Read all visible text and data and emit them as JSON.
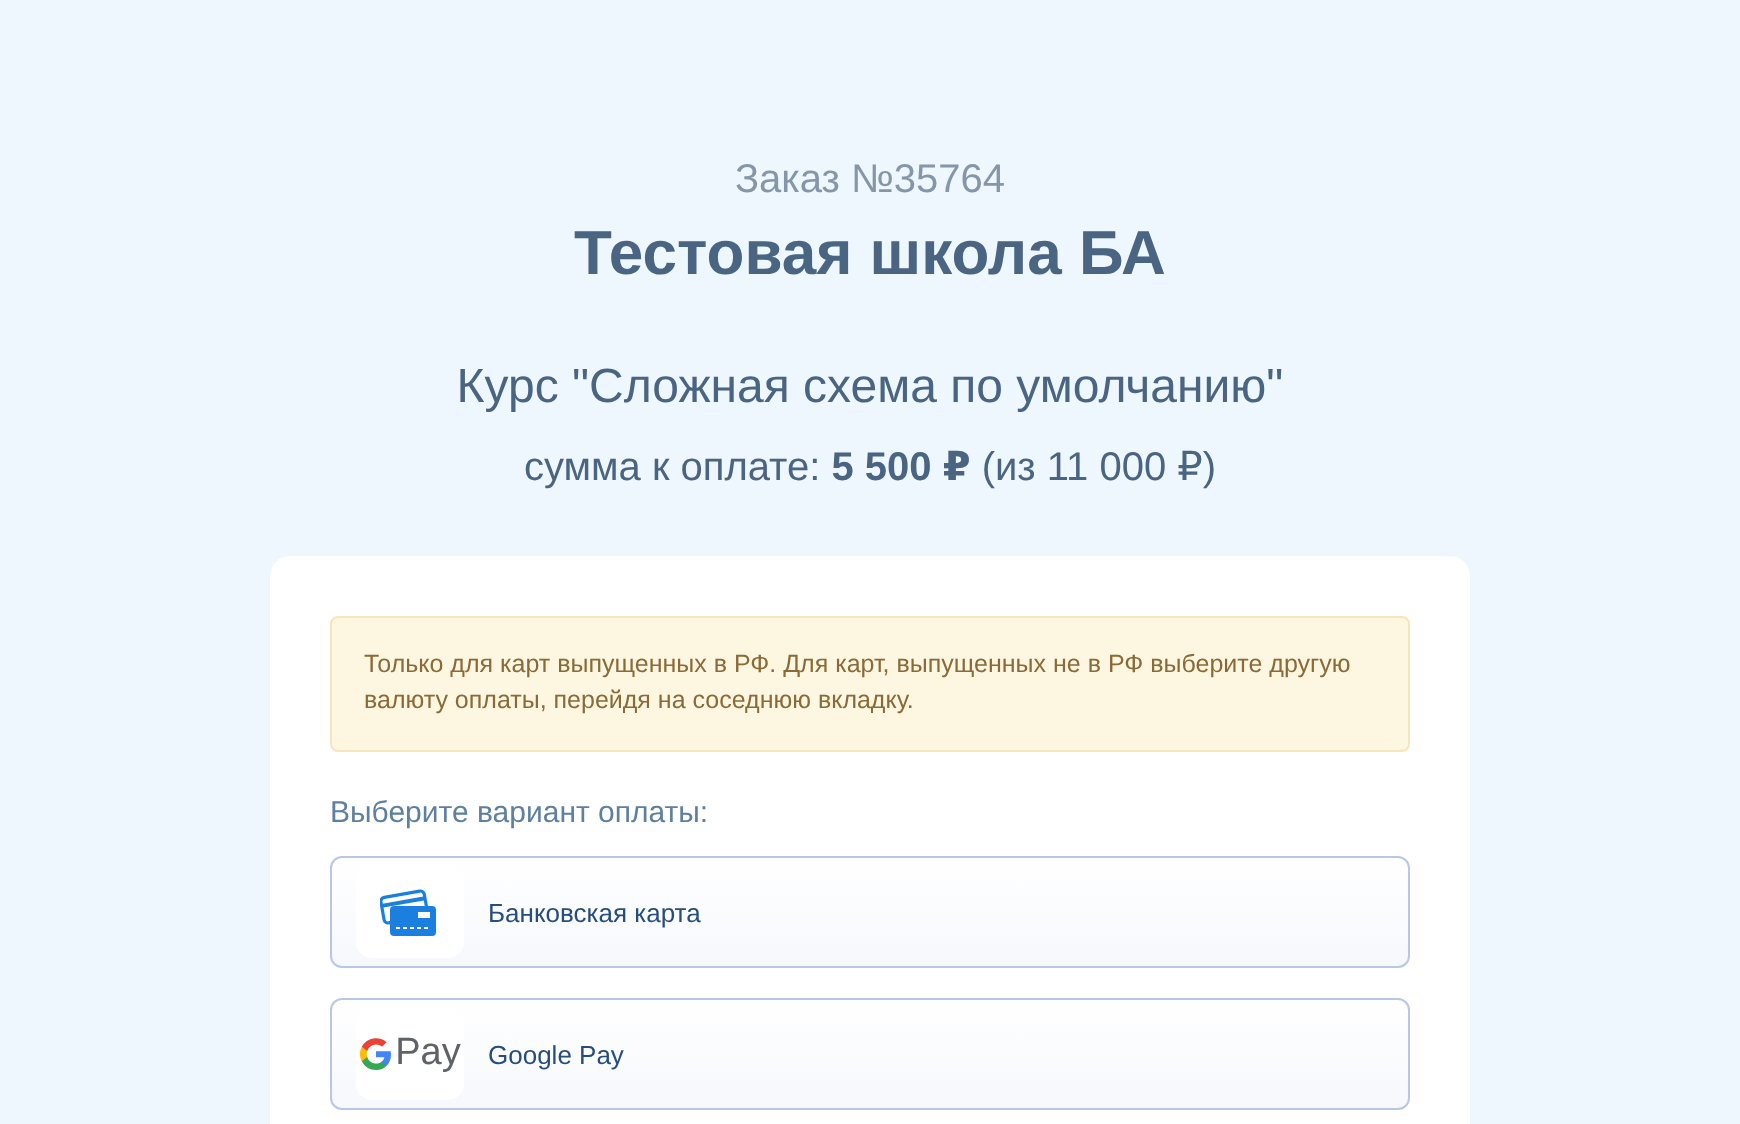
{
  "order": "Заказ №35764",
  "school": "Тестовая школа БА",
  "course": "Курс \"Сложная схема по умолчанию\"",
  "amount": "сумма к оплате: **5 500 ₽** (из 11 000 ₽)",
  "notice": "Только для карт выпущенных в РФ. Для карт, выпущенных не в РФ выберите другую валюту оплаты, перейдя на соседнюю вкладку.",
  "methods_label": "Выберите вариант оплаты:",
  "methods": [
    {
      "kind": "card",
      "label": "Банковская карта"
    },
    {
      "kind": "gpay",
      "logo_text": "Pay",
      "label": "Google Pay"
    }
  ]
}
